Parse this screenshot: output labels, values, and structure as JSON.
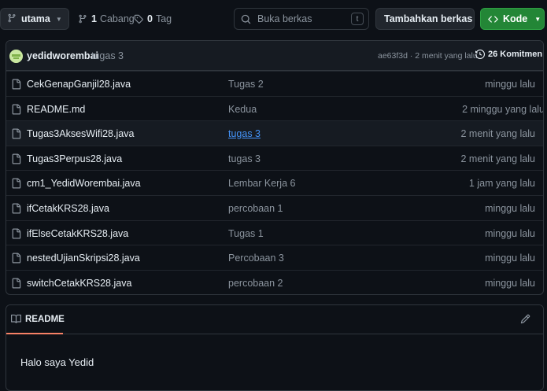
{
  "toolbar": {
    "branch_name": "utama",
    "branches_count": "1",
    "branches_label": "Cabang",
    "tags_count": "0",
    "tags_label": "Tag",
    "search_placeholder": "Buka berkas",
    "search_shortcut": "t",
    "add_file_label": "Tambahkan berkas",
    "code_label": "Kode"
  },
  "commit": {
    "author": "yedidworembai",
    "message": "tugas 3",
    "hash_time": "ae63f3d · 2 menit yang lalu",
    "commits_count": "26 Komitmen"
  },
  "files": [
    {
      "name": "CekGenapGanjil28.java",
      "message": "Tugas 2",
      "time": "minggu lalu"
    },
    {
      "name": "README.md",
      "message": "Kedua",
      "time": "2 minggu yang lalu"
    },
    {
      "name": "Tugas3AksesWifi28.java",
      "message": "tugas 3",
      "time": "2 menit yang lalu"
    },
    {
      "name": "Tugas3Perpus28.java",
      "message": "tugas 3",
      "time": "2 menit yang lalu"
    },
    {
      "name": "cm1_YedidWorembai.java",
      "message": "Lembar Kerja 6",
      "time": "1 jam yang lalu"
    },
    {
      "name": "ifCetakKRS28.java",
      "message": "percobaan 1",
      "time": "minggu lalu"
    },
    {
      "name": "ifElseCetakKRS28.java",
      "message": "Tugas 1",
      "time": "minggu lalu"
    },
    {
      "name": "nestedUjianSkripsi28.java",
      "message": "Percobaan 3",
      "time": "minggu lalu"
    },
    {
      "name": "switchCetakKRS28.java",
      "message": "percobaan 2",
      "time": "minggu lalu"
    }
  ],
  "readme": {
    "tab_label": "README",
    "content": "Halo saya Yedid"
  },
  "colors": {
    "background": "#0d1117",
    "border": "#30363d",
    "primary_button": "#238636",
    "link": "#4493f8",
    "muted_text": "#8b949e",
    "tab_underline": "#f78166"
  }
}
